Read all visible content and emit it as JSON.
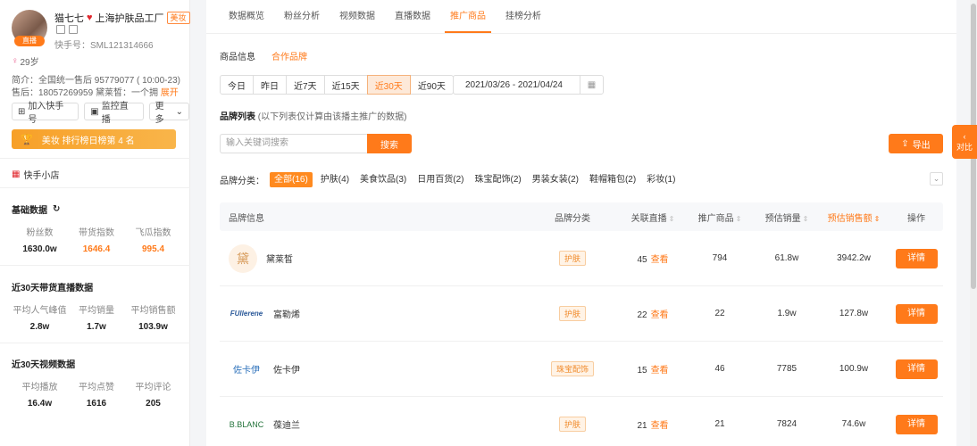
{
  "profile": {
    "name": "猫七七",
    "shop_name": "上海护肤品工厂",
    "tag": "美妆",
    "avatar_tag": "直播",
    "ks_id": "快手号：SML121314666",
    "age": "29岁",
    "intro": "简介：全国统一售后 95779077 ( 10:00-23)",
    "aftersale": "售后：18057269959 黛莱皙：一个拥",
    "expand_label": "展开",
    "buttons": [
      "加入快手号",
      "监控直播",
      "更多"
    ],
    "rank_text": "美妆 排行榜日榜第 4 名",
    "shop_label": "快手小店"
  },
  "basic": {
    "title": "基础数据",
    "stats": [
      {
        "label": "粉丝数",
        "value": "1630.0w"
      },
      {
        "label": "带货指数",
        "value": "1646.4"
      },
      {
        "label": "飞瓜指数",
        "value": "995.4"
      }
    ]
  },
  "live30": {
    "title": "近30天带货直播数据",
    "stats": [
      {
        "label": "平均人气峰值",
        "value": "2.8w"
      },
      {
        "label": "平均销量",
        "value": "1.7w"
      },
      {
        "label": "平均销售额",
        "value": "103.9w"
      }
    ]
  },
  "video30": {
    "title": "近30天视频数据",
    "stats": [
      {
        "label": "平均播放",
        "value": "16.4w"
      },
      {
        "label": "平均点赞",
        "value": "1616"
      },
      {
        "label": "平均评论",
        "value": "205"
      }
    ]
  },
  "tabs": [
    "数据概览",
    "粉丝分析",
    "视频数据",
    "直播数据",
    "推广商品",
    "挂榜分析"
  ],
  "subtabs": [
    "商品信息",
    "合作品牌"
  ],
  "date_buttons": [
    "今日",
    "昨日",
    "近7天",
    "近15天",
    "近30天",
    "近90天"
  ],
  "date_range": "2021/03/26 - 2021/04/24",
  "brand_list": {
    "title": "品牌列表",
    "note": "(以下列表仅计算由该播主推广的数据)"
  },
  "search": {
    "placeholder": "输入关键词搜索",
    "button": "搜索"
  },
  "export_label": "导出",
  "categories": {
    "label": "品牌分类：",
    "items": [
      "全部(16)",
      "护肤(4)",
      "美食饮品(3)",
      "日用百货(2)",
      "珠宝配饰(2)",
      "男装女装(2)",
      "鞋帽箱包(2)",
      "彩妆(1)"
    ]
  },
  "table": {
    "headers": [
      "品牌信息",
      "品牌分类",
      "关联直播",
      "推广商品",
      "预估销量",
      "预估销售额",
      "操作"
    ],
    "view_label": "查看",
    "detail_label": "详情",
    "rows": [
      {
        "logo": "黛",
        "brand": "黛莱皙",
        "category": "护肤",
        "live": "45",
        "products": "794",
        "sales": "61.8w",
        "amount": "3942.2w"
      },
      {
        "logo": "FUllerene",
        "brand": "富勒烯",
        "category": "护肤",
        "live": "22",
        "products": "22",
        "sales": "1.9w",
        "amount": "127.8w"
      },
      {
        "logo": "佐卡伊",
        "brand": "佐卡伊",
        "category": "珠宝配饰",
        "live": "15",
        "products": "46",
        "sales": "7785",
        "amount": "100.9w"
      },
      {
        "logo": "B.BLANC",
        "brand": "葆迪兰",
        "category": "护肤",
        "live": "21",
        "products": "21",
        "sales": "7824",
        "amount": "74.6w"
      }
    ]
  },
  "side_tab": "对比"
}
